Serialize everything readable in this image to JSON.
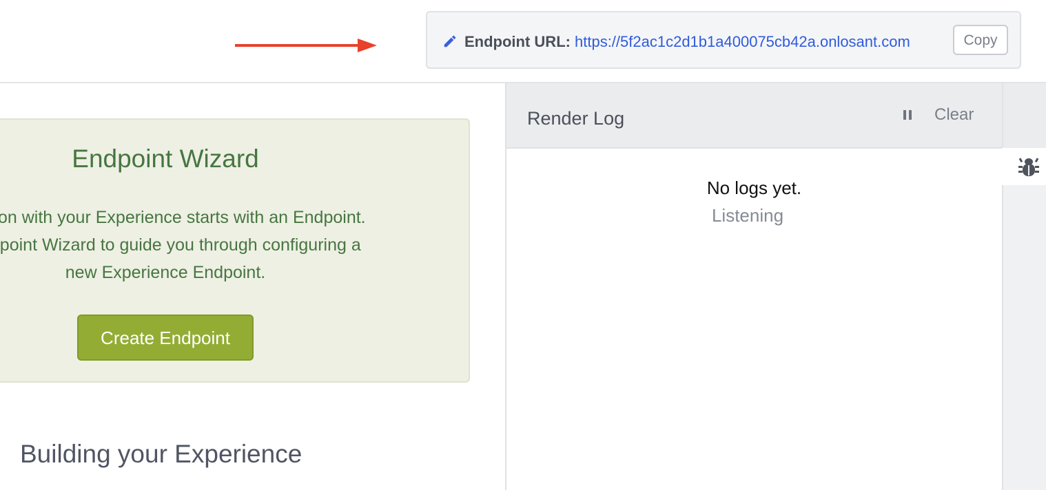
{
  "header": {
    "endpoint_label": "Endpoint URL:",
    "endpoint_url": "https://5f2ac1c2d1b1a400075cb42a.onlosant.com",
    "copy_label": "Copy",
    "annotation_arrow_color": "#e8412c",
    "edit_icon": "pencil-icon"
  },
  "wizard": {
    "title": "Endpoint Wizard",
    "lines": [
      "ction with your Experience starts with an Endpoint.",
      "ndpoint Wizard to guide you through configuring a",
      "new Experience Endpoint."
    ],
    "button_label": "Create Endpoint",
    "button_color": "#93ad34",
    "text_color": "#477640",
    "background": "#eef0e4"
  },
  "main": {
    "section_heading": "Building your Experience"
  },
  "render_log": {
    "title": "Render Log",
    "clear_label": "Clear",
    "pause_icon": "pause-icon",
    "empty_message": "No logs yet.",
    "status": "Listening"
  },
  "right_rail": {
    "debug_icon": "bug-icon"
  }
}
